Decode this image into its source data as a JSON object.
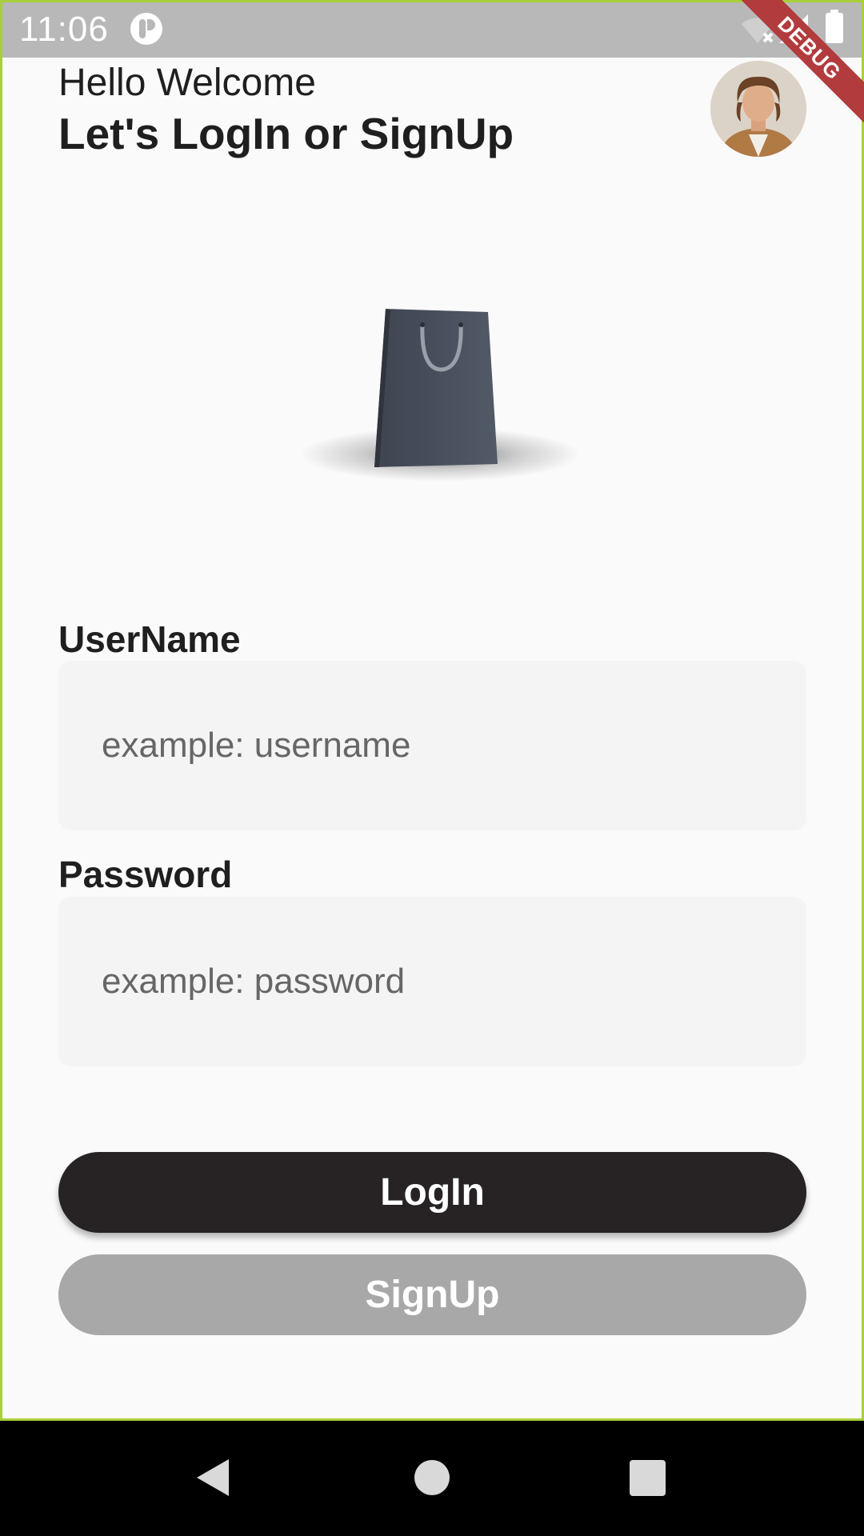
{
  "status_bar": {
    "time": "11:06"
  },
  "debug_banner": "DEBUG",
  "header": {
    "greeting": "Hello Welcome",
    "title": "Let's LogIn or SignUp"
  },
  "form": {
    "username": {
      "label": "UserName",
      "placeholder": "example: username",
      "value": ""
    },
    "password": {
      "label": "Password",
      "placeholder": "example: password",
      "value": ""
    }
  },
  "buttons": {
    "login": "LogIn",
    "signup": "SignUp"
  },
  "colors": {
    "background": "#fafafa",
    "primary_button": "#272324",
    "secondary_button": "#a8a8a8",
    "input_fill": "#f4f4f4",
    "debug_ribbon": "#b23b3e"
  },
  "icons": {
    "status": [
      "app-icon",
      "wifi-off-icon",
      "signal-icon",
      "battery-icon"
    ],
    "nav": [
      "back-icon",
      "home-icon",
      "recents-icon"
    ]
  }
}
